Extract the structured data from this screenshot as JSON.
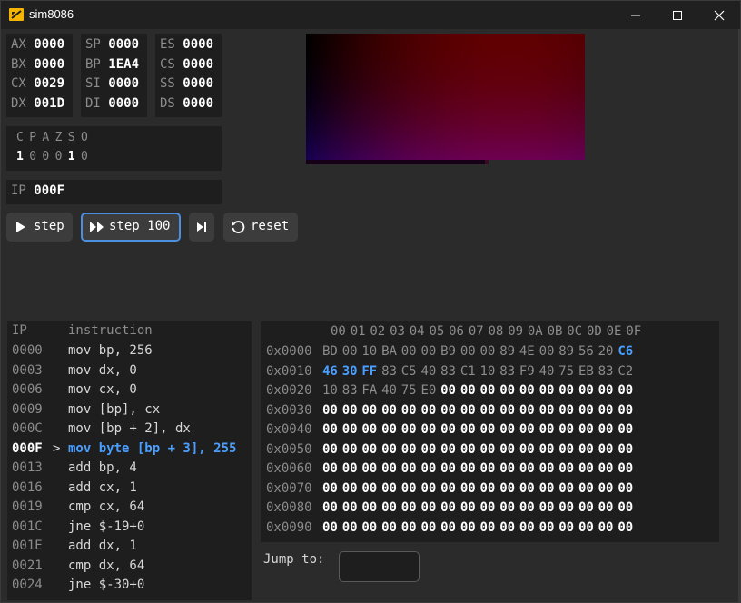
{
  "window": {
    "title": "sim8086",
    "controls": [
      "minimize-icon",
      "maximize-icon",
      "close-icon"
    ]
  },
  "registers": {
    "col1": [
      {
        "name": "AX",
        "value": "0000"
      },
      {
        "name": "BX",
        "value": "0000"
      },
      {
        "name": "CX",
        "value": "0029"
      },
      {
        "name": "DX",
        "value": "001D"
      }
    ],
    "col2": [
      {
        "name": "SP",
        "value": "0000"
      },
      {
        "name": "BP",
        "value": "1EA4"
      },
      {
        "name": "SI",
        "value": "0000"
      },
      {
        "name": "DI",
        "value": "0000"
      }
    ],
    "col3": [
      {
        "name": "ES",
        "value": "0000"
      },
      {
        "name": "CS",
        "value": "0000"
      },
      {
        "name": "SS",
        "value": "0000"
      },
      {
        "name": "DS",
        "value": "0000"
      }
    ]
  },
  "flags": {
    "names": [
      "C",
      "P",
      "A",
      "Z",
      "S",
      "O"
    ],
    "values": [
      "1",
      "0",
      "0",
      "0",
      "1",
      "0"
    ]
  },
  "ip": {
    "label": "IP",
    "value": "000F"
  },
  "toolbar": {
    "step_label": "step",
    "step100_label": "step 100",
    "reset_label": "reset",
    "icons": {
      "step": "play-icon",
      "step100": "fast-forward-icon",
      "run": "skip-to-end-icon",
      "reset": "reset-icon"
    }
  },
  "code": {
    "header_ip": "IP",
    "header_ins": "instruction",
    "current_marker": ">",
    "rows": [
      {
        "ip": "0000",
        "ins": "mov bp, 256"
      },
      {
        "ip": "0003",
        "ins": "mov dx, 0"
      },
      {
        "ip": "0006",
        "ins": "mov cx, 0"
      },
      {
        "ip": "0009",
        "ins": "mov [bp], cx"
      },
      {
        "ip": "000C",
        "ins": "mov [bp + 2], dx"
      },
      {
        "ip": "000F",
        "ins": "mov byte [bp + 3], 255",
        "current": true
      },
      {
        "ip": "0013",
        "ins": "add bp, 4"
      },
      {
        "ip": "0016",
        "ins": "add cx, 1"
      },
      {
        "ip": "0019",
        "ins": "cmp cx, 64"
      },
      {
        "ip": "001C",
        "ins": "jne $-19+0"
      },
      {
        "ip": "001E",
        "ins": "add dx, 1"
      },
      {
        "ip": "0021",
        "ins": "cmp dx, 64"
      },
      {
        "ip": "0024",
        "ins": "jne $-30+0"
      }
    ]
  },
  "memory": {
    "columns": [
      "00",
      "01",
      "02",
      "03",
      "04",
      "05",
      "06",
      "07",
      "08",
      "09",
      "0A",
      "0B",
      "0C",
      "0D",
      "0E",
      "0F"
    ],
    "rows": [
      {
        "addr": "0x0000",
        "bytes": [
          "BD",
          "00",
          "10",
          "BA",
          "00",
          "00",
          "B9",
          "00",
          "00",
          "89",
          "4E",
          "00",
          "89",
          "56",
          "20",
          "C6"
        ],
        "styles": [
          "n",
          "n",
          "n",
          "n",
          "n",
          "n",
          "n",
          "n",
          "n",
          "n",
          "n",
          "n",
          "n",
          "n",
          "n",
          "h"
        ]
      },
      {
        "addr": "0x0010",
        "bytes": [
          "46",
          "30",
          "FF",
          "83",
          "C5",
          "40",
          "83",
          "C1",
          "10",
          "83",
          "F9",
          "40",
          "75",
          "EB",
          "83",
          "C2"
        ],
        "styles": [
          "h",
          "h",
          "h",
          "n",
          "n",
          "n",
          "n",
          "n",
          "n",
          "n",
          "n",
          "n",
          "n",
          "n",
          "n",
          "n"
        ]
      },
      {
        "addr": "0x0020",
        "bytes": [
          "10",
          "83",
          "FA",
          "40",
          "75",
          "E0",
          "00",
          "00",
          "00",
          "00",
          "00",
          "00",
          "00",
          "00",
          "00",
          "00"
        ],
        "styles": [
          "n",
          "n",
          "n",
          "n",
          "n",
          "n",
          "z",
          "z",
          "z",
          "z",
          "z",
          "z",
          "z",
          "z",
          "z",
          "z"
        ]
      },
      {
        "addr": "0x0030",
        "bytes": [
          "00",
          "00",
          "00",
          "00",
          "00",
          "00",
          "00",
          "00",
          "00",
          "00",
          "00",
          "00",
          "00",
          "00",
          "00",
          "00"
        ],
        "styles": [
          "z",
          "z",
          "z",
          "z",
          "z",
          "z",
          "z",
          "z",
          "z",
          "z",
          "z",
          "z",
          "z",
          "z",
          "z",
          "z"
        ]
      },
      {
        "addr": "0x0040",
        "bytes": [
          "00",
          "00",
          "00",
          "00",
          "00",
          "00",
          "00",
          "00",
          "00",
          "00",
          "00",
          "00",
          "00",
          "00",
          "00",
          "00"
        ],
        "styles": [
          "z",
          "z",
          "z",
          "z",
          "z",
          "z",
          "z",
          "z",
          "z",
          "z",
          "z",
          "z",
          "z",
          "z",
          "z",
          "z"
        ]
      },
      {
        "addr": "0x0050",
        "bytes": [
          "00",
          "00",
          "00",
          "00",
          "00",
          "00",
          "00",
          "00",
          "00",
          "00",
          "00",
          "00",
          "00",
          "00",
          "00",
          "00"
        ],
        "styles": [
          "z",
          "z",
          "z",
          "z",
          "z",
          "z",
          "z",
          "z",
          "z",
          "z",
          "z",
          "z",
          "z",
          "z",
          "z",
          "z"
        ]
      },
      {
        "addr": "0x0060",
        "bytes": [
          "00",
          "00",
          "00",
          "00",
          "00",
          "00",
          "00",
          "00",
          "00",
          "00",
          "00",
          "00",
          "00",
          "00",
          "00",
          "00"
        ],
        "styles": [
          "z",
          "z",
          "z",
          "z",
          "z",
          "z",
          "z",
          "z",
          "z",
          "z",
          "z",
          "z",
          "z",
          "z",
          "z",
          "z"
        ]
      },
      {
        "addr": "0x0070",
        "bytes": [
          "00",
          "00",
          "00",
          "00",
          "00",
          "00",
          "00",
          "00",
          "00",
          "00",
          "00",
          "00",
          "00",
          "00",
          "00",
          "00"
        ],
        "styles": [
          "z",
          "z",
          "z",
          "z",
          "z",
          "z",
          "z",
          "z",
          "z",
          "z",
          "z",
          "z",
          "z",
          "z",
          "z",
          "z"
        ]
      },
      {
        "addr": "0x0080",
        "bytes": [
          "00",
          "00",
          "00",
          "00",
          "00",
          "00",
          "00",
          "00",
          "00",
          "00",
          "00",
          "00",
          "00",
          "00",
          "00",
          "00"
        ],
        "styles": [
          "z",
          "z",
          "z",
          "z",
          "z",
          "z",
          "z",
          "z",
          "z",
          "z",
          "z",
          "z",
          "z",
          "z",
          "z",
          "z"
        ]
      },
      {
        "addr": "0x0090",
        "bytes": [
          "00",
          "00",
          "00",
          "00",
          "00",
          "00",
          "00",
          "00",
          "00",
          "00",
          "00",
          "00",
          "00",
          "00",
          "00",
          "00"
        ],
        "styles": [
          "z",
          "z",
          "z",
          "z",
          "z",
          "z",
          "z",
          "z",
          "z",
          "z",
          "z",
          "z",
          "z",
          "z",
          "z",
          "z"
        ]
      }
    ]
  },
  "jump": {
    "label": "Jump to:",
    "value": ""
  },
  "colors": {
    "accent": "#4a9eff",
    "panel": "#1e1e1e",
    "background": "#2b2b2b"
  }
}
